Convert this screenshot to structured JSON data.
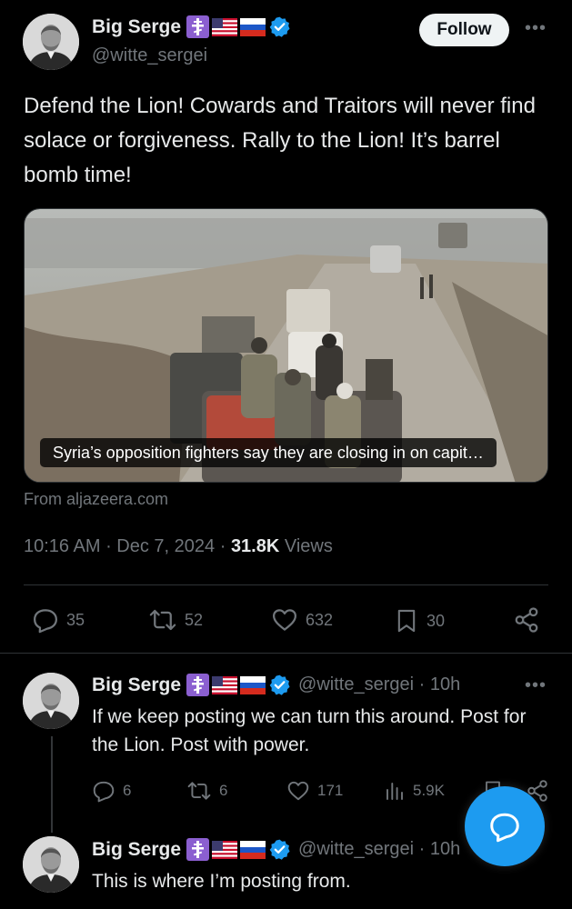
{
  "main_post": {
    "author": "Big Serge",
    "handle": "@witte_sergei",
    "follow_label": "Follow",
    "text": "Defend the Lion! Cowards and Traitors will never find solace or forgiveness. Rally to the Lion! It’s barrel bomb time!",
    "link_caption": "Syria’s opposition fighters say they are closing in on capit…",
    "source": "From aljazeera.com",
    "time": "10:16 AM",
    "date": "Dec 7, 2024",
    "views_count": "31.8K",
    "views_label": "Views",
    "stats": {
      "replies": "35",
      "reposts": "52",
      "likes": "632",
      "bookmarks": "30"
    }
  },
  "replies": [
    {
      "author": "Big Serge",
      "handle": "@witte_sergei",
      "time": "10h",
      "text": "If we keep posting we can turn this around. Post for the Lion. Post with power.",
      "stats": {
        "replies": "6",
        "reposts": "6",
        "likes": "171",
        "views": "5.9K"
      }
    },
    {
      "author": "Big Serge",
      "handle": "@witte_sergei",
      "time": "10h",
      "text": "This is where I’m posting from."
    }
  ],
  "icons": {
    "reply": "reply-icon",
    "repost": "repost-icon",
    "like": "heart-icon",
    "bookmark": "bookmark-icon",
    "share": "share-icon",
    "views": "views-icon",
    "verified": "verified-badge-icon",
    "compose": "compose-reply-icon",
    "badge_cross": "orthodox-cross-icon",
    "flag_us": "us-flag-icon",
    "flag_ru": "russia-flag-icon"
  },
  "colors": {
    "accent": "#1d9bf0",
    "background": "#000000",
    "text": "#e7e9ea",
    "muted": "#71767b",
    "divider": "#2f3336",
    "badge_purple": "#8b5fd0"
  }
}
